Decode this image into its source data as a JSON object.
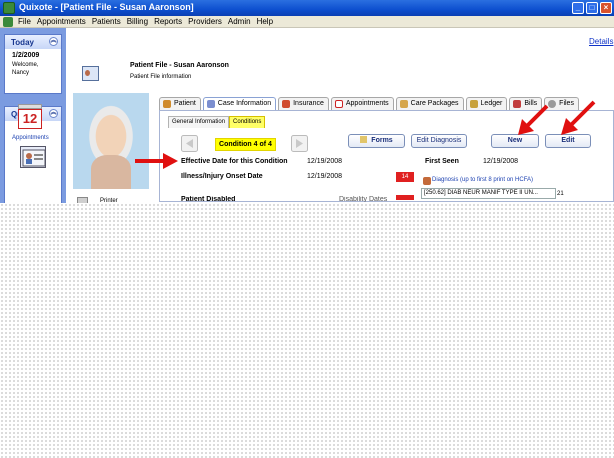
{
  "window": {
    "title": "Quixote - [Patient File - Susan Aaronson]"
  },
  "menu": {
    "items": [
      "File",
      "Appointments",
      "Patients",
      "Billing",
      "Reports",
      "Providers",
      "Admin",
      "Help"
    ]
  },
  "today_panel": {
    "heading": "Today",
    "date": "1/2/2009",
    "welcome": "Welcome,",
    "user": "Nancy"
  },
  "quixote_panel": {
    "heading": "Quixote",
    "calendar_day": "12",
    "appointments_label": "Appointments"
  },
  "header": {
    "details_link": "Details",
    "title": "Patient File - Susan Aaronson",
    "subtitle": "Patient File information"
  },
  "tabs": [
    "Patient",
    "Case Information",
    "Insurance",
    "Appointments",
    "Care Packages",
    "Ledger",
    "Bills",
    "Files"
  ],
  "active_tab": "Case Information",
  "subtabs": [
    "General Information",
    "Conditions"
  ],
  "active_subtab": "Conditions",
  "condition_nav": {
    "label": "Condition 4 of 4"
  },
  "buttons": {
    "forms": "Forms",
    "edit_diagnosis": "Edit Diagnosis",
    "new": "New",
    "edit": "Edit"
  },
  "fields": {
    "effective_date_label": "Effective Date for this Condition",
    "effective_date_value": "12/19/2008",
    "onset_label": "Illness/Injury Onset Date",
    "onset_value": "12/19/2008",
    "onset_badge": "14",
    "first_seen_label": "First Seen",
    "first_seen_value": "12/19/2008",
    "partial_label": "Patient Disabled",
    "partial_value": "Disability Dates"
  },
  "diagnosis": {
    "title": "Diagnosis (up to first 8 print on HCFA)",
    "first_row": "[250.62] DIAB NEUR MANIF TYPE II UN...",
    "first_row_number": "21"
  },
  "photo_panel": {
    "printer_label": "Printer"
  },
  "colors": {
    "titlebar": "#0d4fcf",
    "left_panel": "#7b9be0",
    "highlight": "#ffff00",
    "alert": "#e02020",
    "annotation_arrow": "#e01010"
  }
}
